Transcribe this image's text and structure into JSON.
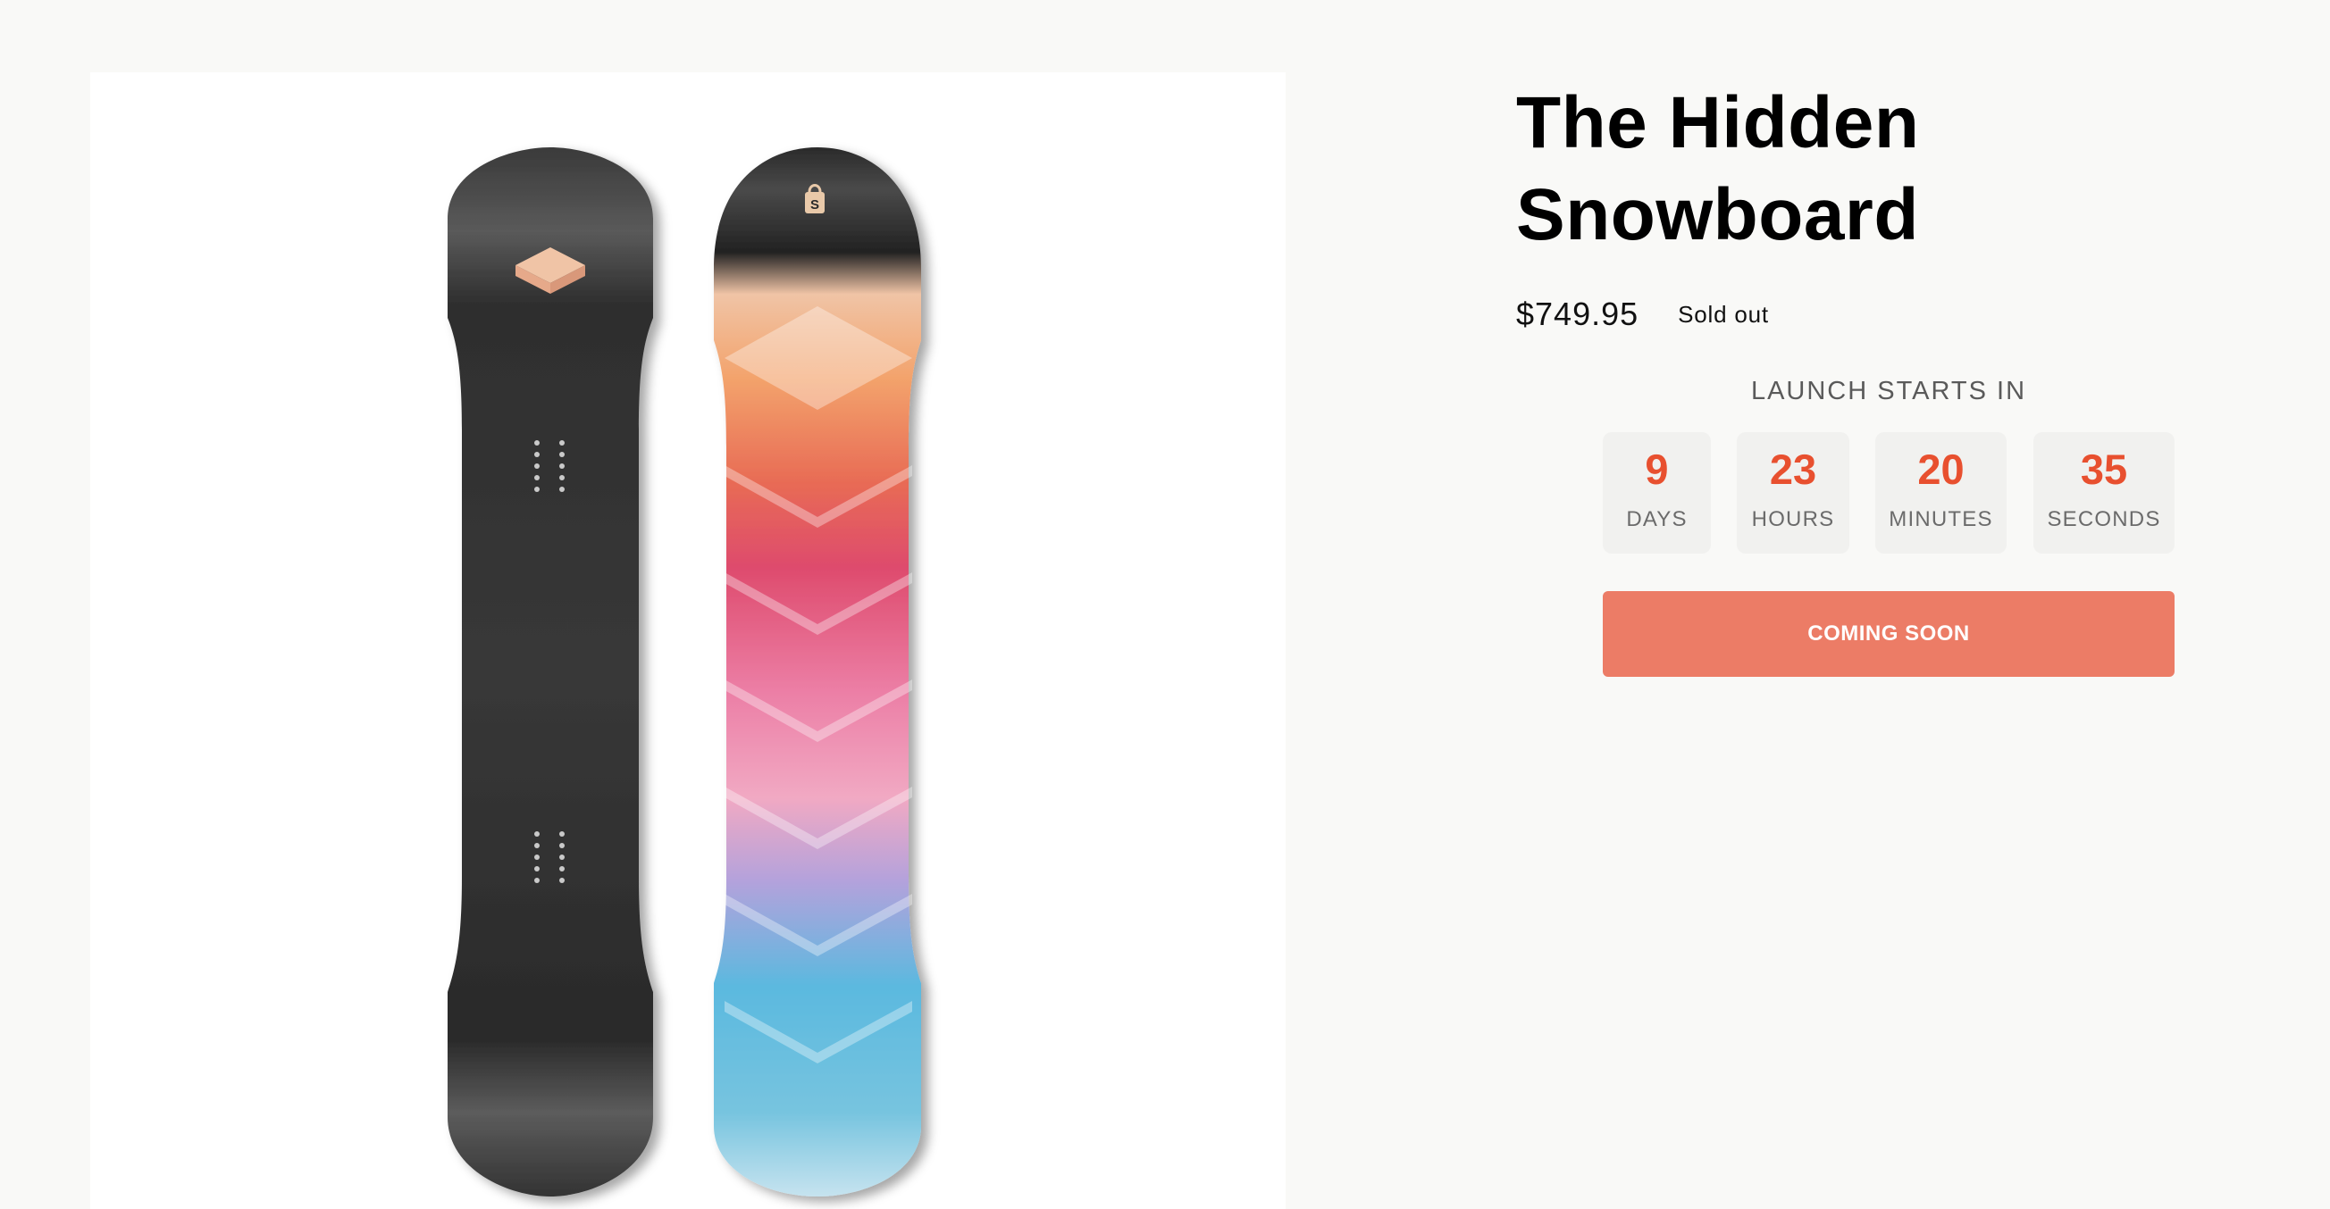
{
  "product": {
    "title_line1": "The Hidden",
    "title_line2": "Snowboard",
    "price": "$749.95",
    "status": "Sold out",
    "image_alt": "The Hidden Snowboard"
  },
  "launch": {
    "heading": "LAUNCH STARTS IN",
    "units": [
      {
        "value": "9",
        "label": "DAYS"
      },
      {
        "value": "23",
        "label": "HOURS"
      },
      {
        "value": "20",
        "label": "MINUTES"
      },
      {
        "value": "35",
        "label": "SECONDS"
      }
    ]
  },
  "cta": {
    "label": "COMING SOON"
  },
  "colors": {
    "accent": "#e8502f",
    "button": "#ec7c66",
    "board_base": "#2b2b2b"
  }
}
